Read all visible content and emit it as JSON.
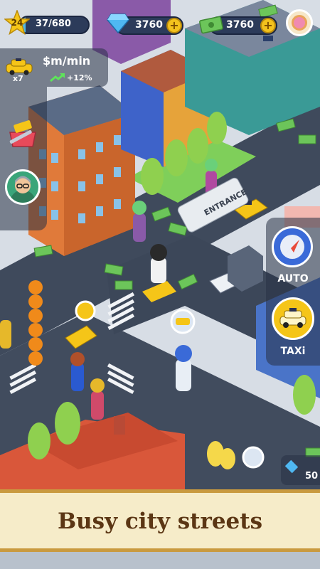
{
  "hud": {
    "level": "24",
    "xp": "37/680",
    "xp_progress": 0.054,
    "gems": "3760",
    "cash": "3760",
    "taxi_count": "x7",
    "income_label": "$m/min",
    "income_change": "+12%"
  },
  "map": {
    "entrance_label": "ENTRANCE"
  },
  "buttons": {
    "auto_label": "AUTO",
    "taxi_label": "TAXi",
    "partial_value": "50"
  },
  "banner": {
    "caption": "Busy city streets"
  },
  "colors": {
    "road": "#3f4a5c",
    "sidewalk": "#dfe4ea",
    "grass": "#7fcf5a",
    "taxi_yellow": "#f5c518",
    "banner_bg": "#f6ecc9",
    "banner_text": "#5b3614"
  }
}
